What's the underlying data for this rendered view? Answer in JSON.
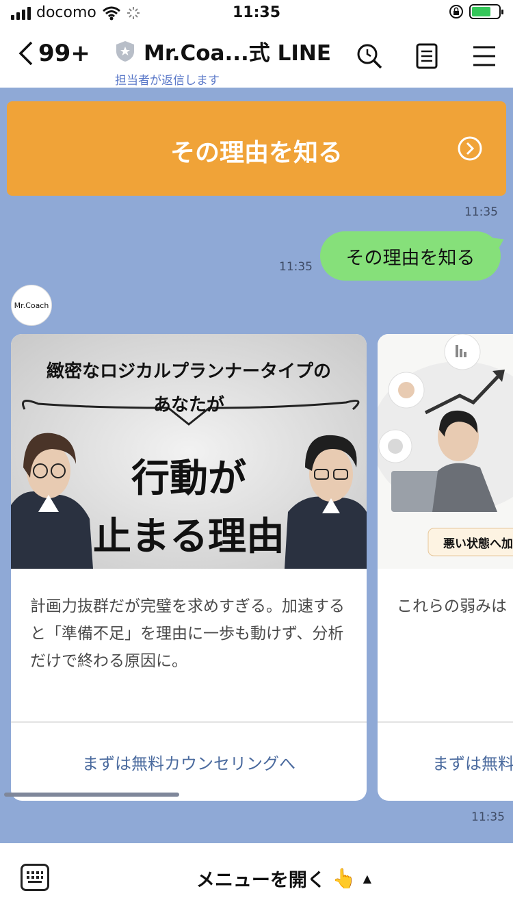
{
  "status_bar": {
    "carrier": "docomo",
    "time": "11:35"
  },
  "header": {
    "back_count": "99+",
    "title": "Mr.Coa...式 LINE",
    "subtitle": "担当者が返信します",
    "icons": [
      "search-icon",
      "notes-icon",
      "menu-icon"
    ]
  },
  "chat": {
    "orange_button_label": "その理由を知る",
    "time_1": "11:35",
    "sent_message": "その理由を知る",
    "time_2": "11:35",
    "avatar_text": "Mr.Coach",
    "cards": [
      {
        "img_line1": "緻密なロジカルプランナータイプの",
        "img_line2": "あなたが",
        "img_big1": "行動が",
        "img_big2": "止まる理由",
        "text": "計画力抜群だが完璧を求めすぎる。加速すると「準備不足」を理由に一歩も動けず、分析だけで終わる原因に。",
        "action": "まずは無料カウンセリングへ"
      },
      {
        "img_label": "悪い状態へ加",
        "text": "これらの弱みは うちに加速し、 ります。",
        "action": "まずは無料"
      }
    ],
    "time_3": "11:35"
  },
  "bottom": {
    "menu_label": "メニューを開く",
    "emoji": "👆",
    "caret": "▲"
  },
  "colors": {
    "orange": "#f0a338",
    "bubble_green": "#86e07a",
    "chat_bg": "#8fa9d6",
    "link": "#4a6a9e"
  }
}
